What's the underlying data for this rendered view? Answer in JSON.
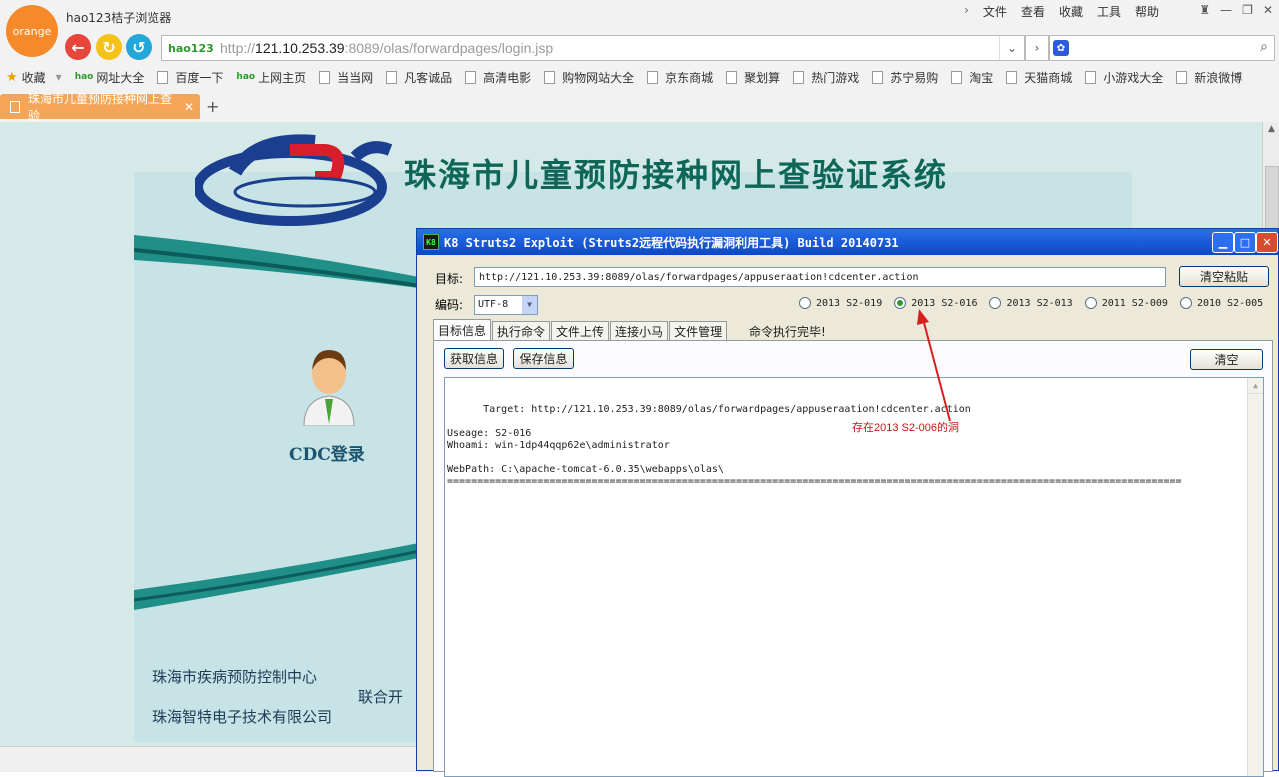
{
  "browser": {
    "logo_text": "orange",
    "app_title": "hao123桔子浏览器",
    "menu": [
      "文件",
      "查看",
      "收藏",
      "工具",
      "帮助"
    ],
    "window_controls": [
      "shirt",
      "minimize",
      "restore",
      "close"
    ],
    "url_prefix": "http://",
    "url_host": "121.10.253.39",
    "url_rest": ":8089/olas/forwardpages/login.jsp",
    "hao_logo": "hao123",
    "bookmarks": [
      "收藏",
      "网址大全",
      "百度一下",
      "上网主页",
      "当当网",
      "凡客诚品",
      "高清电影",
      "购物网站大全",
      "京东商城",
      "聚划算",
      "热门游戏",
      "苏宁易购",
      "淘宝",
      "天猫商城",
      "小游戏大全",
      "新浪微博"
    ],
    "tab_title": "珠海市儿童预防接种网上查验",
    "accent": "#f5a558"
  },
  "page": {
    "site_title": "珠海市儿童预防接种网上查验证系统",
    "logo_text": "CDC",
    "login_label": "CDC登录",
    "org1": "珠海市疾病预防控制中心",
    "org2": "联合开",
    "org3": "珠海智特电子技术有限公司"
  },
  "tool": {
    "title": "K8 Struts2 Exploit (Struts2远程代码执行漏洞利用工具)  Build 20140731",
    "target_label": "目标:",
    "target_value": "http://121.10.253.39:8089/olas/forwardpages/appuseraation!cdcenter.action",
    "clear_paste": "清空粘贴",
    "encoding_label": "编码:",
    "encoding_value": "UTF-8",
    "radios": [
      {
        "label": "2013 S2-019",
        "selected": false
      },
      {
        "label": "2013 S2-016",
        "selected": true
      },
      {
        "label": "2013 S2-013",
        "selected": false
      },
      {
        "label": "2011 S2-009",
        "selected": false
      },
      {
        "label": "2010 S2-005",
        "selected": false
      }
    ],
    "tabs": [
      "目标信息",
      "执行命令",
      "文件上传",
      "连接小马",
      "文件管理"
    ],
    "status": "命令执行完毕!",
    "get_info": "获取信息",
    "save_info": "保存信息",
    "clear": "清空",
    "output": "Target: http://121.10.253.39:8089/olas/forwardpages/appuseraation!cdcenter.action\n\nUseage: S2-016\nWhoami: win-1dp44qqp62e\\administrator\n\nWebPath: C:\\apache-tomcat-6.0.35\\webapps\\olas\\\n==========================================================================================================================",
    "annotation": "存在2013 S2-006的洞",
    "annotation_color": "#c81414"
  }
}
